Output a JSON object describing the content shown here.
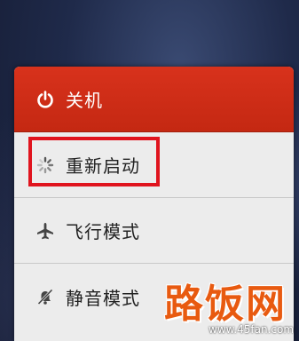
{
  "menu": {
    "items": [
      {
        "label": "关机",
        "icon": "power-icon"
      },
      {
        "label": "重新启动",
        "icon": "reboot-spinner-icon"
      },
      {
        "label": "飞行模式",
        "icon": "airplane-icon"
      },
      {
        "label": "静音模式",
        "icon": "mute-bell-icon"
      }
    ]
  },
  "watermark": {
    "logo_text": "路饭网",
    "url": "www.45fan.com"
  },
  "colors": {
    "power_bar": "#d8321c",
    "highlight_border": "#e0141e",
    "menu_bg": "#ececec",
    "watermark": "#e85a10"
  }
}
